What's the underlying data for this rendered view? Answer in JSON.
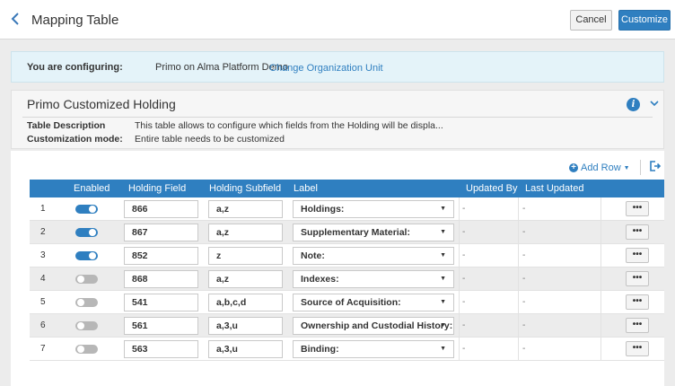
{
  "header": {
    "title": "Mapping Table",
    "cancel_label": "Cancel",
    "customize_label": "Customize"
  },
  "config": {
    "label": "You are configuring:",
    "value": "Primo on Alma Platform Demo",
    "link": "Change Organization Unit"
  },
  "details": {
    "title": "Primo Customized Holding",
    "table_description_key": "Table Description",
    "table_description_value": "This table allows to configure which fields from the Holding will be displa...",
    "customization_mode_key": "Customization mode:",
    "customization_mode_value": "Entire table needs to be customized"
  },
  "toolbar": {
    "add_row_label": "Add Row"
  },
  "table": {
    "headers": {
      "enabled": "Enabled",
      "holding_field": "Holding Field",
      "holding_subfield": "Holding Subfield",
      "label": "Label",
      "updated_by": "Updated By",
      "last_updated": "Last Updated"
    },
    "rows": [
      {
        "num": "1",
        "enabled": true,
        "field": "866",
        "subfield": "a,z",
        "label": "Holdings:",
        "updated_by": "-",
        "last_updated": "-"
      },
      {
        "num": "2",
        "enabled": true,
        "field": "867",
        "subfield": "a,z",
        "label": "Supplementary Material:",
        "updated_by": "-",
        "last_updated": "-"
      },
      {
        "num": "3",
        "enabled": true,
        "field": "852",
        "subfield": "z",
        "label": "Note:",
        "updated_by": "-",
        "last_updated": "-"
      },
      {
        "num": "4",
        "enabled": false,
        "field": "868",
        "subfield": "a,z",
        "label": "Indexes:",
        "updated_by": "-",
        "last_updated": "-"
      },
      {
        "num": "5",
        "enabled": false,
        "field": "541",
        "subfield": "a,b,c,d",
        "label": "Source of Acquisition:",
        "updated_by": "-",
        "last_updated": "-"
      },
      {
        "num": "6",
        "enabled": false,
        "field": "561",
        "subfield": "a,3,u",
        "label": "Ownership and Custodial History:",
        "updated_by": "-",
        "last_updated": "-"
      },
      {
        "num": "7",
        "enabled": false,
        "field": "563",
        "subfield": "a,3,u",
        "label": "Binding:",
        "updated_by": "-",
        "last_updated": "-"
      }
    ],
    "more_label": "•••"
  },
  "colors": {
    "accent": "#2f7fc0",
    "toggle_off": "#b7b7b7",
    "banner": "#e4f3f9"
  }
}
